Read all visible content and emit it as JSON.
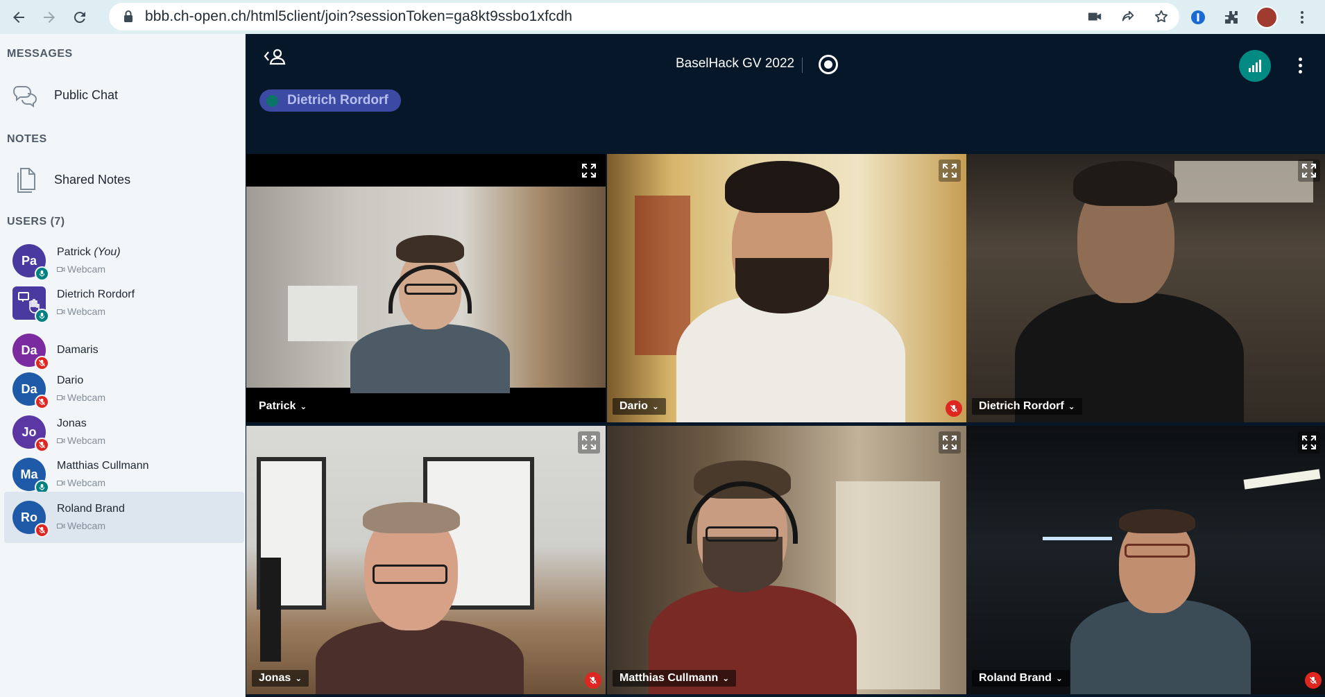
{
  "browser": {
    "url": "bbb.ch-open.ch/html5client/join?sessionToken=ga8kt9ssbo1xfcdh"
  },
  "sidebar": {
    "messages_title": "MESSAGES",
    "public_chat": "Public Chat",
    "notes_title": "NOTES",
    "shared_notes": "Shared Notes",
    "users_title": "USERS (7)",
    "users": [
      {
        "initials": "Pa",
        "name": "Patrick",
        "suffix": "(You)",
        "sub": "Webcam",
        "color": "#4a3aa0",
        "mic": "on"
      },
      {
        "initials": "",
        "name": "Dietrich Rordorf",
        "suffix": "",
        "sub": "Webcam",
        "color": "#4a3aa0",
        "mic": "on"
      },
      {
        "initials": "Da",
        "name": "Damaris",
        "suffix": "",
        "sub": "",
        "color": "#7b2ba0",
        "mic": "off"
      },
      {
        "initials": "Da",
        "name": "Dario",
        "suffix": "",
        "sub": "Webcam",
        "color": "#1e5aa8",
        "mic": "off"
      },
      {
        "initials": "Jo",
        "name": "Jonas",
        "suffix": "",
        "sub": "Webcam",
        "color": "#5b37a3",
        "mic": "off"
      },
      {
        "initials": "Ma",
        "name": "Matthias Cullmann",
        "suffix": "",
        "sub": "Webcam",
        "color": "#1e5aa8",
        "mic": "on"
      },
      {
        "initials": "Ro",
        "name": "Roland Brand",
        "suffix": "",
        "sub": "Webcam",
        "color": "#1e5aa8",
        "mic": "off"
      }
    ]
  },
  "main": {
    "meeting_title": "BaselHack GV 2022",
    "talking": "Dietrich Rordorf"
  },
  "videos": [
    {
      "name": "Patrick",
      "muted": false
    },
    {
      "name": "Dario",
      "muted": true
    },
    {
      "name": "Dietrich Rordorf",
      "muted": false
    },
    {
      "name": "Jonas",
      "muted": true
    },
    {
      "name": "Matthias Cullmann",
      "muted": false
    },
    {
      "name": "Roland Brand",
      "muted": true
    }
  ],
  "icons": {
    "back": "arrow-left-icon",
    "forward": "arrow-right-icon",
    "reload": "reload-icon",
    "lock": "lock-icon",
    "camera": "camera-icon",
    "share": "share-icon",
    "star": "star-icon",
    "extension": "puzzle-icon",
    "menu": "kebab-icon"
  },
  "colors": {
    "accent": "#008a82",
    "muted": "#df2721",
    "talker": "#3d4aa3",
    "bg": "#06172a"
  }
}
